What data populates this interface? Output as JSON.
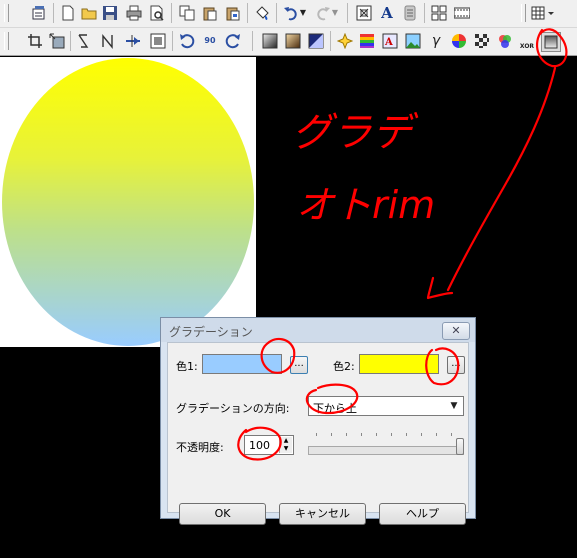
{
  "toolbar_row1": {
    "icons": [
      "toolbar-options-icon",
      "new-file-icon",
      "open-folder-icon",
      "save-icon",
      "print-icon",
      "print-preview-icon",
      "copy-icon",
      "paste-icon",
      "paste-special-icon",
      "fill-icon",
      "undo-icon",
      "undo-dropdown-icon",
      "redo-icon",
      "redo-dropdown-icon",
      "fit-window-icon",
      "text-icon",
      "align-icon",
      "grid-view-icon",
      "filmstrip-icon",
      "layout-menu-icon"
    ],
    "text_glyph": "A"
  },
  "toolbar_row2": {
    "icons": [
      "crop-icon",
      "resize-icon",
      "flip-horizontal-icon",
      "flip-vertical-icon",
      "move-icon",
      "border-icon",
      "rotate-left-icon",
      "rotate-90-icon",
      "rotate-right-icon",
      "grayscale-icon",
      "sepia-icon",
      "negative-icon",
      "sharpen-icon",
      "color-balance-icon",
      "text-overlay-icon",
      "picture-icon",
      "gamma-icon",
      "color-wheel-icon",
      "mosaic-icon",
      "rgb-icon",
      "xor-icon",
      "gradient-icon"
    ],
    "gamma_glyph": "γ",
    "xor_glyph": "XOR",
    "rotate_90_label": "90"
  },
  "dialog": {
    "title": "グラデーション",
    "close_glyph": "✕",
    "color1_label": "色1:",
    "color1_value": "#99ccff",
    "color2_label": "色2:",
    "color2_value": "#ffff00",
    "browse_label": "...",
    "direction_label": "グラデーションの方向:",
    "direction_value": "下から上",
    "opacity_label": "不透明度:",
    "opacity_value": "100",
    "opacity_slider_fraction": 1.0,
    "ok_label": "OK",
    "cancel_label": "キャンセル",
    "help_label": "ヘルプ"
  },
  "canvas": {
    "gradient_top_color": "#ffff00",
    "gradient_bottom_color": "#99ccff"
  },
  "annotation": {
    "line1": "グラデ",
    "line2": "オトrim",
    "ink_color": "#ff0000"
  }
}
